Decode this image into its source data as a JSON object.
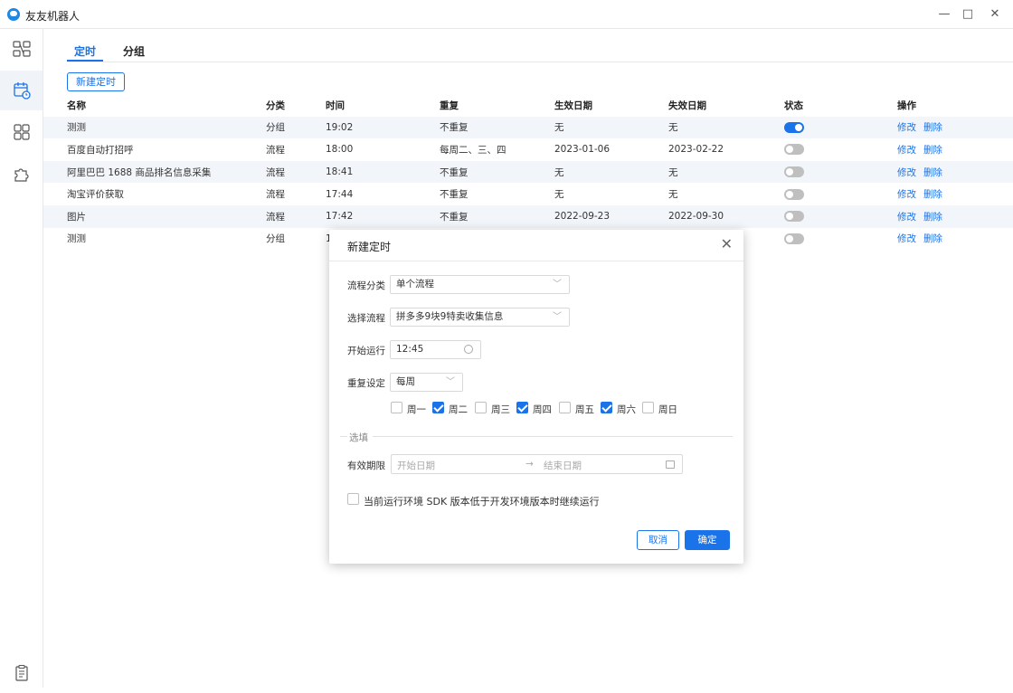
{
  "app": {
    "title": "友友机器人"
  },
  "window": {
    "minimize": "—",
    "maximize": "□",
    "close": "✕"
  },
  "sidebar": {
    "items": [
      {
        "name": "flow"
      },
      {
        "name": "schedule",
        "active": true
      },
      {
        "name": "apps"
      },
      {
        "name": "plugins"
      }
    ],
    "bottom": {
      "name": "log"
    }
  },
  "tabs": [
    {
      "label": "定时",
      "active": true
    },
    {
      "label": "分组",
      "active": false
    }
  ],
  "toolbar": {
    "new_label": "新建定时"
  },
  "table": {
    "headers": [
      "名称",
      "分类",
      "时间",
      "重复",
      "生效日期",
      "失效日期",
      "状态",
      "操作"
    ],
    "rows": [
      {
        "name": "测测",
        "category": "分组",
        "time": "19:02",
        "repeat": "不重复",
        "start": "无",
        "end": "无",
        "enabled": true
      },
      {
        "name": "百度自动打招呼",
        "category": "流程",
        "time": "18:00",
        "repeat": "每周二、三、四",
        "start": "2023-01-06",
        "end": "2023-02-22",
        "enabled": false
      },
      {
        "name": "阿里巴巴 1688 商品排名信息采集",
        "category": "流程",
        "time": "18:41",
        "repeat": "不重复",
        "start": "无",
        "end": "无",
        "enabled": false
      },
      {
        "name": "淘宝评价获取",
        "category": "流程",
        "time": "17:44",
        "repeat": "不重复",
        "start": "无",
        "end": "无",
        "enabled": false
      },
      {
        "name": "图片",
        "category": "流程",
        "time": "17:42",
        "repeat": "不重复",
        "start": "2022-09-23",
        "end": "2022-09-30",
        "enabled": false
      },
      {
        "name": "测测",
        "category": "分组",
        "time": "1",
        "repeat": "",
        "start": "",
        "end": "",
        "enabled": false
      }
    ],
    "edit_label": "修改",
    "delete_label": "删除"
  },
  "dialog": {
    "title": "新建定时",
    "close": "✕",
    "flow_category_label": "流程分类",
    "flow_category_value": "单个流程",
    "flow_select_label": "选择流程",
    "flow_select_value": "拼多多9块9特卖收集信息",
    "start_label": "开始运行",
    "start_value": "12:45",
    "repeat_label": "重复设定",
    "repeat_value": "每周",
    "weekdays": [
      {
        "label": "周一",
        "checked": false
      },
      {
        "label": "周二",
        "checked": true
      },
      {
        "label": "周三",
        "checked": false
      },
      {
        "label": "周四",
        "checked": true
      },
      {
        "label": "周五",
        "checked": false
      },
      {
        "label": "周六",
        "checked": true
      },
      {
        "label": "周日",
        "checked": false
      }
    ],
    "optional_label": "选填",
    "validity_label": "有效期限",
    "start_date_placeholder": "开始日期",
    "range_sep": "→",
    "end_date_placeholder": "结束日期",
    "sdk_checkbox_label": "当前运行环境 SDK 版本低于开发环境版本时继续运行",
    "cancel_label": "取消",
    "ok_label": "确定"
  },
  "colors": {
    "accent": "#1a73e8",
    "row_alt": "#f2f6fa"
  }
}
